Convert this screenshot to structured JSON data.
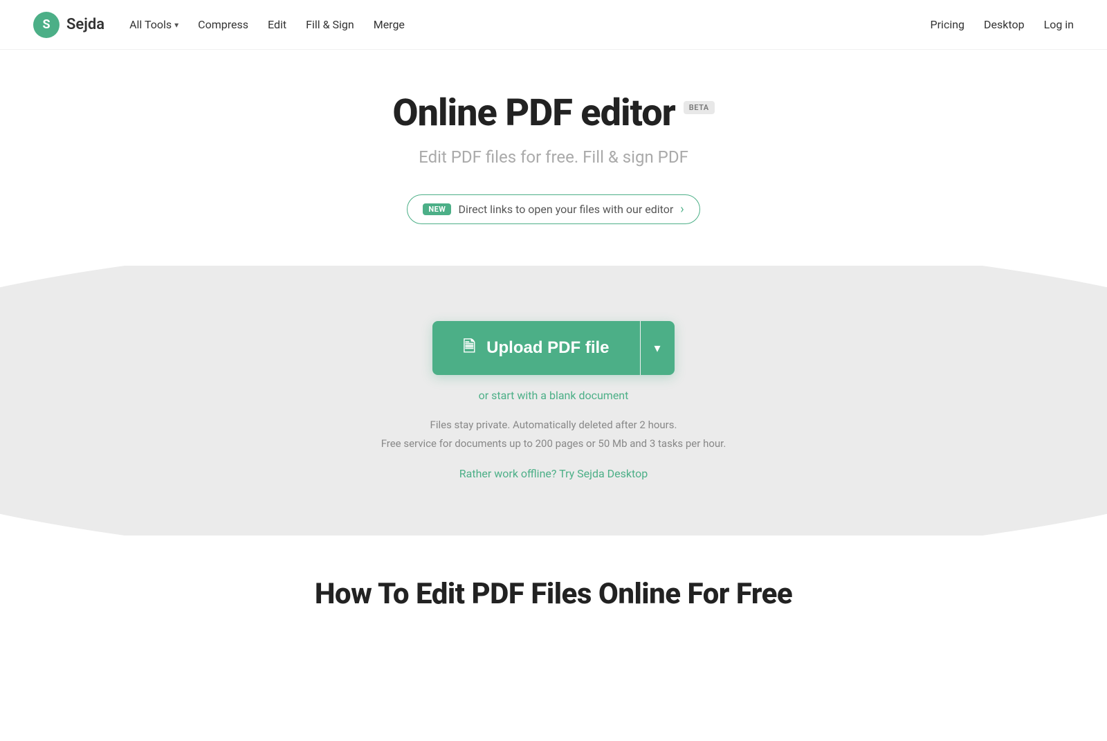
{
  "nav": {
    "logo_letter": "S",
    "logo_name": "Sejda",
    "all_tools_label": "All Tools",
    "compress_label": "Compress",
    "edit_label": "Edit",
    "fill_sign_label": "Fill & Sign",
    "merge_label": "Merge",
    "pricing_label": "Pricing",
    "desktop_label": "Desktop",
    "login_label": "Log in"
  },
  "hero": {
    "title": "Online PDF editor",
    "beta_label": "BETA",
    "subtitle": "Edit PDF files for free. Fill & sign PDF",
    "new_tag": "NEW",
    "new_banner_text": "Direct links to open your files with our editor",
    "new_banner_arrow": "›"
  },
  "upload": {
    "button_label": "Upload PDF file",
    "dropdown_arrow": "▾",
    "blank_doc_text": "or start with a blank document",
    "info_line1": "Files stay private. Automatically deleted after 2 hours.",
    "info_line2": "Free service for documents up to 200 pages or 50 Mb and 3 tasks per hour.",
    "offline_text": "Rather work offline? Try Sejda Desktop"
  },
  "bottom": {
    "title": "How To Edit PDF Files Online For Free"
  }
}
